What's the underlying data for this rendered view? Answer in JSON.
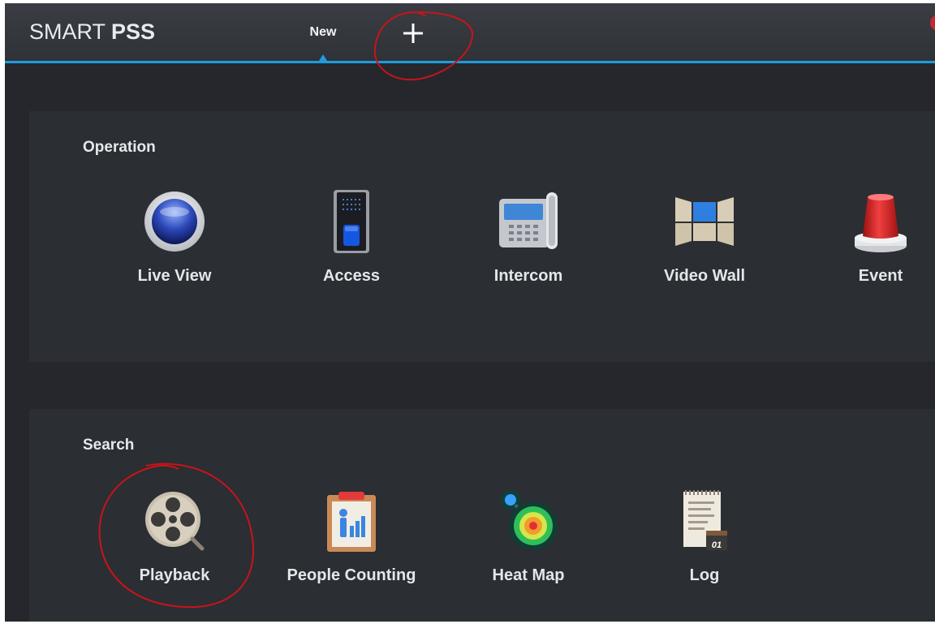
{
  "app": {
    "brand_light": "SMART ",
    "brand_bold": "PSS",
    "tabs": [
      {
        "label": "New"
      }
    ],
    "add_tab_icon": "plus-icon"
  },
  "colors": {
    "background": "#25272c",
    "titlebar": "#35383d",
    "accent": "#1e9be0",
    "panel": "#2b2e33",
    "annotation": "#c8141a"
  },
  "sections": {
    "operation": {
      "title": "Operation",
      "items": [
        {
          "label": "Live View",
          "icon": "live-view-camera-icon"
        },
        {
          "label": "Access",
          "icon": "access-fingerprint-icon"
        },
        {
          "label": "Intercom",
          "icon": "intercom-phone-icon"
        },
        {
          "label": "Video Wall",
          "icon": "video-wall-icon"
        },
        {
          "label": "Event",
          "icon": "event-alarm-icon"
        }
      ]
    },
    "search": {
      "title": "Search",
      "items": [
        {
          "label": "Playback",
          "icon": "playback-film-reel-icon"
        },
        {
          "label": "People Counting",
          "icon": "people-counting-clipboard-icon"
        },
        {
          "label": "Heat Map",
          "icon": "heat-map-icon"
        },
        {
          "label": "Log",
          "icon": "log-document-icon",
          "badge": "01"
        }
      ]
    }
  }
}
